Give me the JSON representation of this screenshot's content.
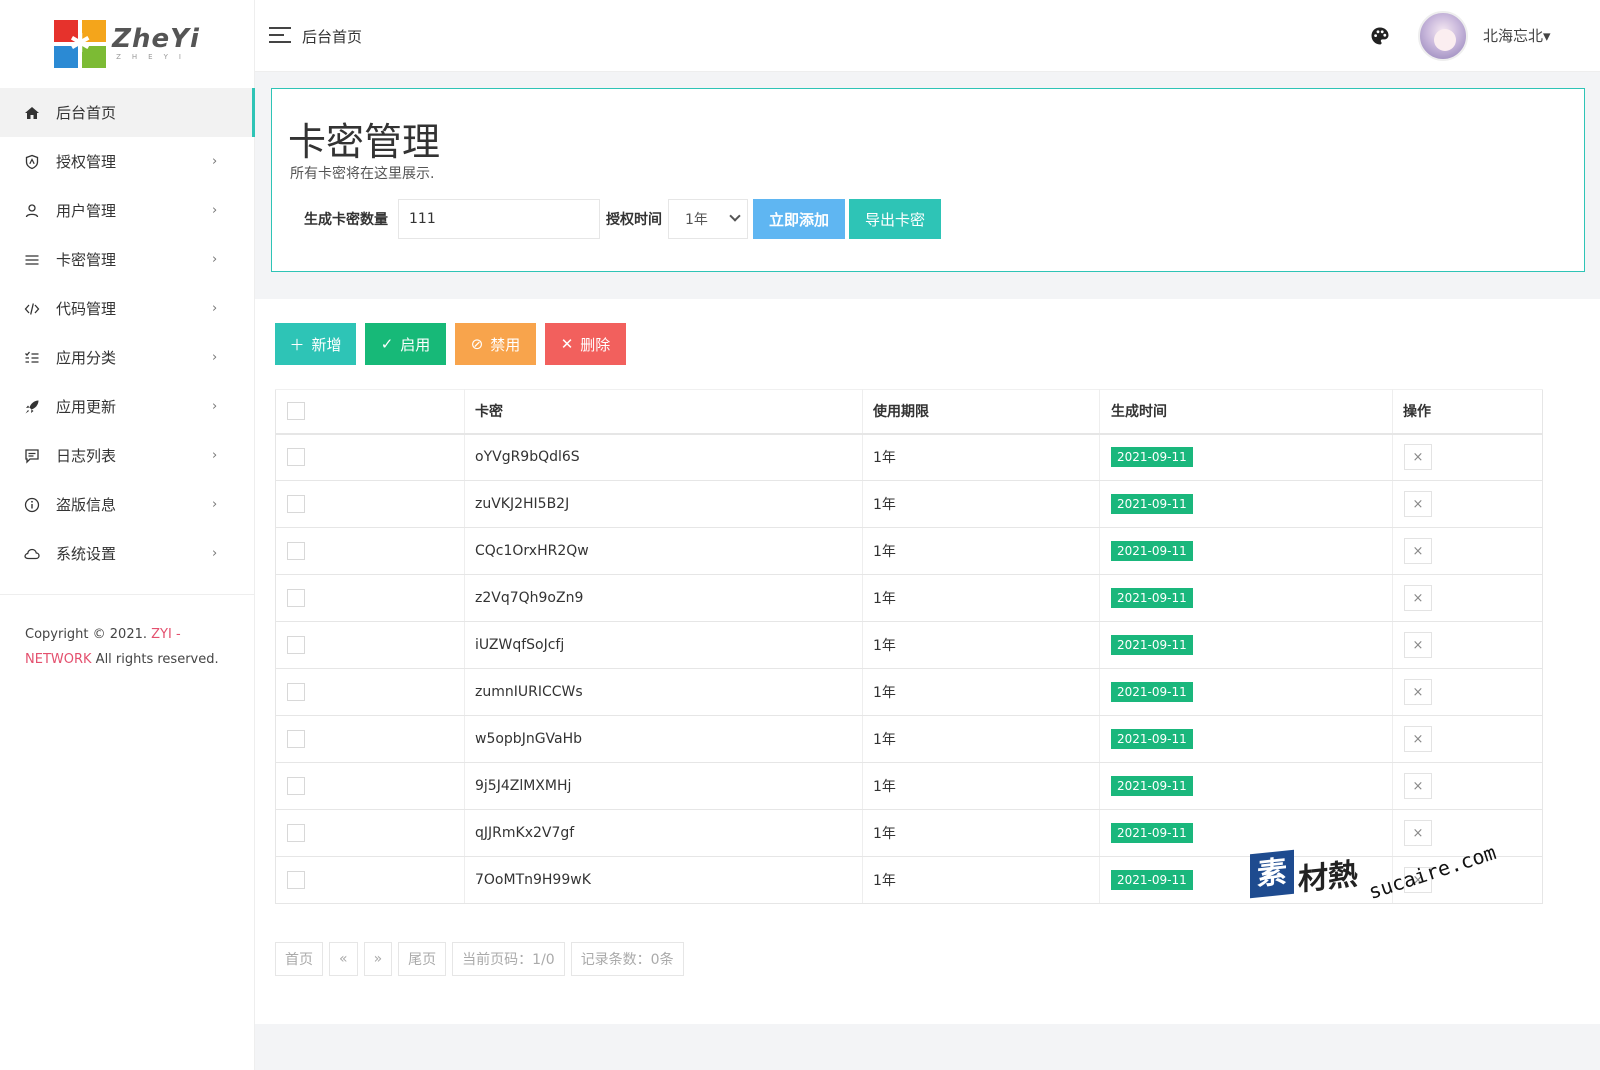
{
  "logo": {
    "name": "ZheYi",
    "sub": "ZHEYI"
  },
  "sidebar": {
    "items": [
      {
        "label": "后台首页",
        "icon": "home-icon"
      },
      {
        "label": "授权管理",
        "icon": "shield-icon"
      },
      {
        "label": "用户管理",
        "icon": "user-icon"
      },
      {
        "label": "卡密管理",
        "icon": "list-icon"
      },
      {
        "label": "代码管理",
        "icon": "code-icon"
      },
      {
        "label": "应用分类",
        "icon": "category-icon"
      },
      {
        "label": "应用更新",
        "icon": "rocket-icon"
      },
      {
        "label": "日志列表",
        "icon": "message-icon"
      },
      {
        "label": "盗版信息",
        "icon": "info-icon"
      },
      {
        "label": "系统设置",
        "icon": "cloud-icon"
      }
    ],
    "chevron": "›",
    "copyright_prefix": "Copyright © 2021.",
    "copyright_brand": "ZYI - NETWORK",
    "copyright_suffix": "All rights reserved."
  },
  "topbar": {
    "title": "后台首页",
    "username": "北海忘北▾"
  },
  "card_panel": {
    "title": "卡密管理",
    "subtitle": "所有卡密将在这里展示.",
    "qty_label": "生成卡密数量",
    "qty_value": "111",
    "time_label": "授权时间",
    "time_value": "1年",
    "add_now_label": "立即添加",
    "export_label": "导出卡密"
  },
  "actions": {
    "new_label": "新增",
    "enable_label": "启用",
    "disable_label": "禁用",
    "delete_label": "删除"
  },
  "table": {
    "headers": [
      "卡密",
      "使用期限",
      "生成时间",
      "操作"
    ],
    "rows": [
      {
        "key": "oYVgR9bQdl6S",
        "limit": "1年",
        "date": "2021-09-11"
      },
      {
        "key": "zuVKJ2HI5B2J",
        "limit": "1年",
        "date": "2021-09-11"
      },
      {
        "key": "CQc1OrxHR2Qw",
        "limit": "1年",
        "date": "2021-09-11"
      },
      {
        "key": "z2Vq7Qh9oZn9",
        "limit": "1年",
        "date": "2021-09-11"
      },
      {
        "key": "iUZWqfSoJcfj",
        "limit": "1年",
        "date": "2021-09-11"
      },
      {
        "key": "zumnIURICCWs",
        "limit": "1年",
        "date": "2021-09-11"
      },
      {
        "key": "w5opbJnGVaHb",
        "limit": "1年",
        "date": "2021-09-11"
      },
      {
        "key": "9j5J4ZlMXMHj",
        "limit": "1年",
        "date": "2021-09-11"
      },
      {
        "key": "qJJRmKx2V7gf",
        "limit": "1年",
        "date": "2021-09-11"
      },
      {
        "key": "7OoMTn9H99wK",
        "limit": "1年",
        "date": "2021-09-11"
      }
    ],
    "delete_glyph": "×"
  },
  "pager": {
    "first": "首页",
    "prev": "«",
    "next": "»",
    "last": "尾页",
    "current": "当前页码：1/0",
    "records": "记录条数：0条"
  },
  "watermark": {
    "box": "素",
    "cn": "材熱",
    "en": "sucaire.com"
  },
  "colors": {
    "accent": "#2ec4b6",
    "primary_blue": "#5fb6f2",
    "success": "#17b978",
    "warning": "#f8a44c",
    "danger": "#f2605d",
    "brand_red": "#e4506e"
  }
}
